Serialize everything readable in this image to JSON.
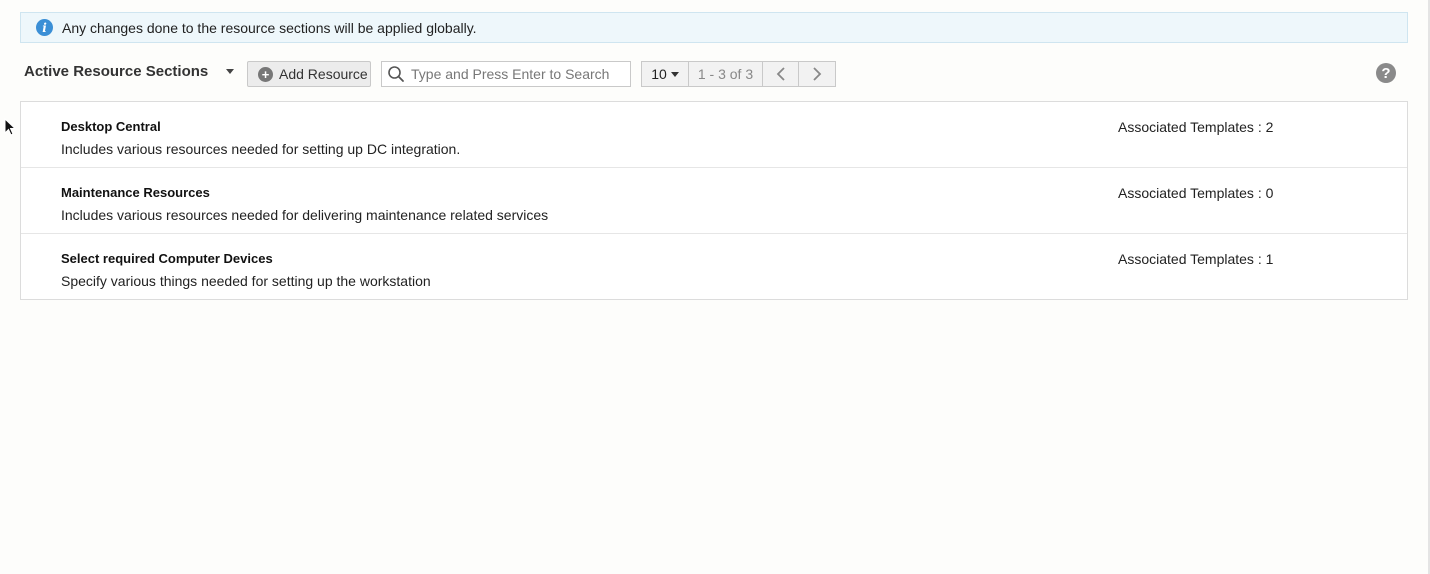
{
  "info_banner": {
    "icon": "info-icon",
    "text": "Any changes done to the resource sections will be applied globally."
  },
  "toolbar": {
    "section_selector": "Active Resource Sections",
    "add_button": "Add Resource",
    "search_placeholder": "Type and Press Enter to Search",
    "page_size": "10",
    "page_range": "1 - 3 of 3",
    "prev_glyph": "<",
    "next_glyph": ">",
    "help_glyph": "?"
  },
  "resources": [
    {
      "title": "Desktop Central",
      "description": "Includes various resources needed for setting up DC integration.",
      "associated": "Associated Templates : 2"
    },
    {
      "title": "Maintenance Resources",
      "description": "Includes various resources needed for delivering maintenance related services",
      "associated": "Associated Templates : 0"
    },
    {
      "title": "Select required Computer Devices",
      "description": "Specify various things needed for setting up the workstation",
      "associated": "Associated Templates : 1"
    }
  ],
  "colors": {
    "banner_bg": "#eef7fb",
    "info_icon": "#3b8fd6",
    "button_bg": "#ececec"
  }
}
